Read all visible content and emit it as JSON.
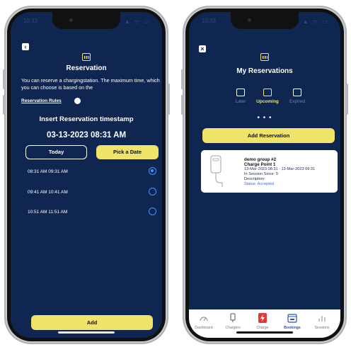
{
  "left_screen": {
    "status": {
      "time": "10:33",
      "signal": "▲ ᯤ ▭"
    },
    "back_icon": "chevron-left-icon",
    "header_icon": "calendar-icon",
    "title": "Reservation",
    "description": "You can reserve a chargingstation. The maximum time, which you can choose is based on the",
    "rules_link": "Reservation Rules",
    "insert_title": "Insert Reservation timestamp",
    "timestamp": "03-13-2023 08:31 AM",
    "today_label": "Today",
    "pick_date_label": "Pick a Date",
    "slots": [
      {
        "label": "08:31 AM 09:31 AM",
        "selected": true
      },
      {
        "label": "09:41 AM 10:41 AM",
        "selected": false
      },
      {
        "label": "10:51 AM 11:51 AM",
        "selected": false
      }
    ],
    "add_label": "Add"
  },
  "right_screen": {
    "status": {
      "time": "10:33",
      "signal": "▲ ᯤ ▭"
    },
    "close_icon": "close-icon",
    "header_icon": "calendar-icon",
    "title": "My Reservations",
    "tabs": [
      {
        "label": "Later",
        "active": false
      },
      {
        "label": "Upcoming",
        "active": true
      },
      {
        "label": "Expired",
        "active": false
      }
    ],
    "more_dots": "• • •",
    "add_reservation_label": "Add Reservation",
    "card": {
      "group": "demo group #2",
      "charge_point": "Charge Point 1",
      "period": "13-Mar-2023 08:31 - 13-Mar-2023 09:31",
      "in_session": "In Session Since: 0",
      "description": "Description:",
      "status": "Status: Accepted"
    },
    "nav": [
      {
        "label": "Dashboard",
        "icon": "gauge-icon",
        "active": false
      },
      {
        "label": "Chargers",
        "icon": "charger-icon",
        "active": false
      },
      {
        "label": "Charge",
        "icon": "bolt-icon",
        "active": false
      },
      {
        "label": "Bookings",
        "icon": "calendar-icon",
        "active": true
      },
      {
        "label": "Sessions",
        "icon": "bar-chart-icon",
        "active": false
      }
    ]
  },
  "colors": {
    "screen_bg": "#0f2750",
    "accent_yellow": "#f0e36a",
    "radio_blue": "#4a90ff",
    "nav_active": "#2a52b0"
  }
}
